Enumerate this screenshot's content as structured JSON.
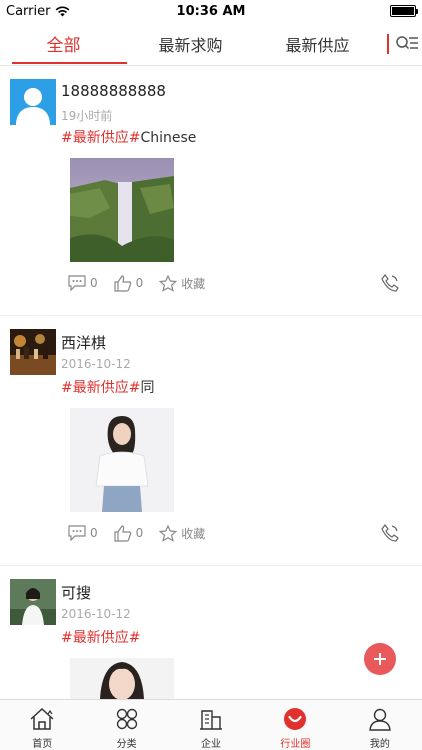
{
  "status_bar": {
    "carrier": "Carrier",
    "time": "10:36 AM"
  },
  "tabs": [
    {
      "label": "全部",
      "active": true
    },
    {
      "label": "最新求购",
      "active": false
    },
    {
      "label": "最新供应",
      "active": false
    }
  ],
  "posts": [
    {
      "name": "18888888888",
      "time": "19小时前",
      "tag": "#最新供应#",
      "text": "Chinese",
      "comments": "0",
      "likes": "0",
      "favorite": "收藏",
      "avatar": "default-avatar-icon",
      "photo": "waterfall"
    },
    {
      "name": "西洋棋",
      "time": "2016-10-12",
      "tag": "#最新供应#",
      "text": "同",
      "comments": "0",
      "likes": "0",
      "favorite": "收藏",
      "avatar": "chess",
      "photo": "woman-white-top"
    },
    {
      "name": "可搜",
      "time": "2016-10-12",
      "tag": "#最新供应#",
      "text": "",
      "avatar": "person-portrait",
      "photo": "woman-portrait"
    }
  ],
  "bottom_nav": [
    {
      "label": "首页",
      "icon": "home-icon",
      "active": false
    },
    {
      "label": "分类",
      "icon": "category-icon",
      "active": false
    },
    {
      "label": "企业",
      "icon": "building-icon",
      "active": false
    },
    {
      "label": "行业圈",
      "icon": "circle-icon",
      "active": true
    },
    {
      "label": "我的",
      "icon": "user-icon",
      "active": false
    }
  ],
  "colors": {
    "accent": "#e0312e",
    "fab": "#e9585a"
  }
}
